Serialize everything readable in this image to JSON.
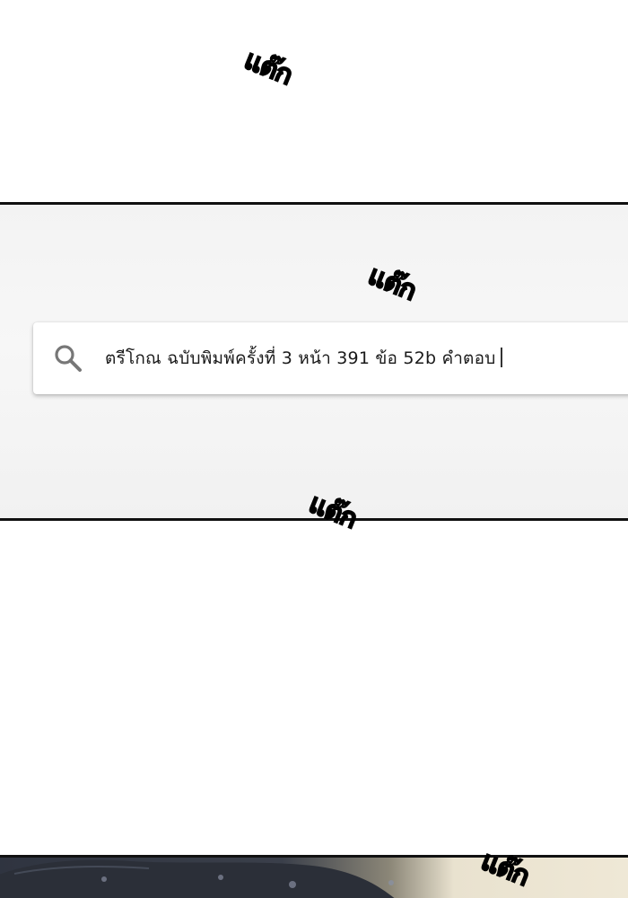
{
  "sfx": {
    "text": "แต๊ก"
  },
  "search": {
    "query": "ตรีโกณ ฉบับพิมพ์ครั้งที่ 3 หน้า 391 ข้อ 52b คำตอบ"
  },
  "icons": {
    "search": "search-icon"
  },
  "colors": {
    "panel_border": "#111111",
    "panel_background": "#f4f4f4",
    "search_background": "#ffffff",
    "icon": "#777777"
  }
}
